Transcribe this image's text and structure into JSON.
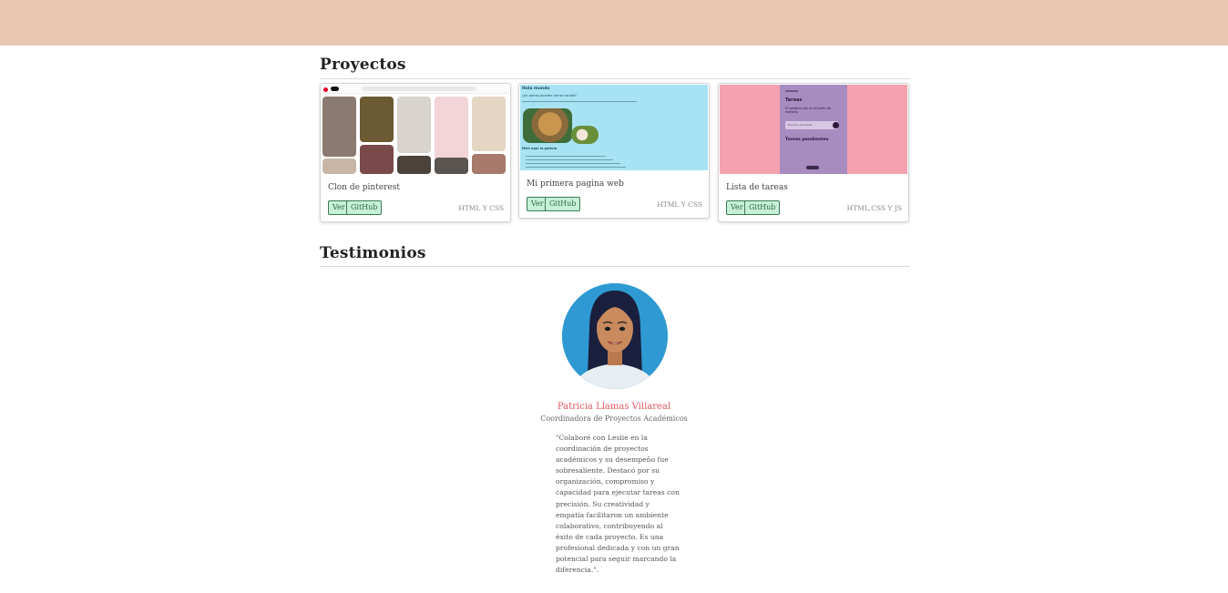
{
  "sections": {
    "projects_title": "Proyectos",
    "testimonials_title": "Testimonios"
  },
  "projects": [
    {
      "title": "Clon de pinterest",
      "view_label": "Ver",
      "github_label": "GitHub",
      "tech": "HTML Y CSS"
    },
    {
      "title": "Mi primera pagina web",
      "view_label": "Ver",
      "github_label": "GitHub",
      "tech": "HTML Y CSS"
    },
    {
      "title": "Lista de tareas",
      "view_label": "Ver",
      "github_label": "GitHub",
      "tech": "HTML,CSS Y JS"
    }
  ],
  "thumb_text": {
    "web_heading": "Hola mundo",
    "web_sub": "¿Un perros pueden comer sandía?",
    "web_caption": "Mire aquí la galería",
    "task_title": "Tareas",
    "task_sub": "El solsticio hoy en el solén de mañana",
    "task_input": "Escribe una tarea",
    "task_pending": "Tareas pendientes"
  },
  "testimonial": {
    "name": "Patricia Llamas Villareal",
    "role": "Coordinadora de Proyectos Académicos",
    "quote": "\"Colaboré con Leslie en la coordinación de proyectos académicos y su desempeño fue sobresaliente. Destacó por su organización, compromiso y capacidad para ejecutar tareas con precisión. Su creatividad y empatía facilitaron un ambiente colaborativo, contribuyendo al éxito de cada proyecto. Es una profesional dedicada y con un gran potencial para seguir marcando la diferencia.\"."
  },
  "colors": {
    "header": "#e8c7b0",
    "button_bg": "#c7f0d8",
    "button_border": "#3c7a55",
    "name": "#e0575f",
    "avatar_bg": "#2e99d2"
  }
}
